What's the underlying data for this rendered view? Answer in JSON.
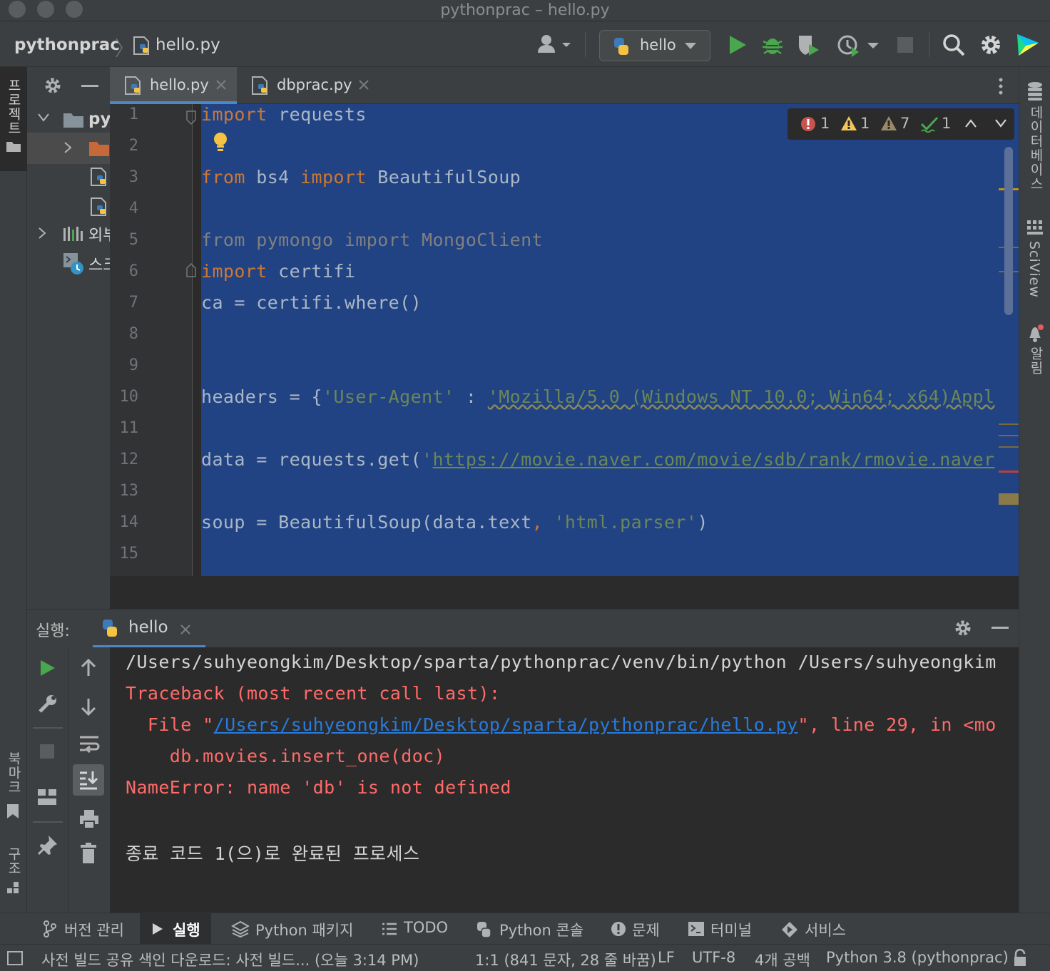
{
  "window": {
    "title": "pythonprac – hello.py"
  },
  "nav": {
    "project": "pythonprac",
    "file": "hello.py",
    "run_config": "hello"
  },
  "left_strip": {
    "project": "프로젝트",
    "bookmarks": "북마크",
    "structure": "구조"
  },
  "right_strip": {
    "database": "데이터베이스",
    "sciview": "SciView",
    "notifications": "알림"
  },
  "project_tree": {
    "root": "py",
    "external": "외부",
    "scratch": "스크"
  },
  "tabs": [
    {
      "label": "hello.py"
    },
    {
      "label": "dbprac.py"
    }
  ],
  "inspections": {
    "errors": "1",
    "warnings": "1",
    "weak_warnings": "7",
    "typos": "1"
  },
  "editor": {
    "line_numbers": [
      "1",
      "2",
      "3",
      "4",
      "5",
      "6",
      "7",
      "8",
      "9",
      "10",
      "11",
      "12",
      "13",
      "14",
      "15"
    ],
    "l1": {
      "kw": "import",
      "rest": " requests"
    },
    "l3": {
      "kw1": "from",
      "mid": " bs4 ",
      "kw2": "import",
      "rest": " BeautifulSoup"
    },
    "l5": {
      "text": "from pymongo import MongoClient"
    },
    "l6": {
      "kw": "import",
      "rest": " certifi"
    },
    "l7": {
      "text": "ca = certifi.where()"
    },
    "l10": {
      "a": "headers = {",
      "b": "'User-Agent'",
      "c": " : ",
      "d": "'Mozilla/5.0 (Windows NT 10.0; Win64; x64)Appl"
    },
    "l12": {
      "a": "data = requests.get(",
      "q": "'",
      "url": "https://movie.naver.com/movie/sdb/rank/rmovie.naver"
    },
    "l14": {
      "a": "soup = BeautifulSoup(data.text",
      "comma": ",",
      "sp": " ",
      "str": "'html.parser'",
      "end": ")"
    }
  },
  "run": {
    "label": "실행:",
    "tab": "hello",
    "output": {
      "cmd": "/Users/suhyeongkim/Desktop/sparta/pythonprac/venv/bin/python /Users/suhyeongkim",
      "tb": "Traceback (most recent call last):",
      "file_pre": "  File \"",
      "file_path": "/Users/suhyeongkim/Desktop/sparta/pythonprac/hello.py",
      "file_post": "\", line 29, in <mo",
      "code": "    db.movies.insert_one(doc)",
      "err": "NameError: name 'db' is not defined",
      "exit": "종료 코드 1(으)로 완료된 프로세스"
    }
  },
  "tool_windows": [
    {
      "label": "버전 관리",
      "icon": "branch-icon"
    },
    {
      "label": "실행",
      "icon": "play-icon"
    },
    {
      "label": "Python 패키지",
      "icon": "layers-icon"
    },
    {
      "label": "TODO",
      "icon": "list-icon"
    },
    {
      "label": "Python 콘솔",
      "icon": "python-icon"
    },
    {
      "label": "문제",
      "icon": "alert-icon"
    },
    {
      "label": "터미널",
      "icon": "terminal-icon"
    },
    {
      "label": "서비스",
      "icon": "services-icon"
    }
  ],
  "status": {
    "message": "사전 빌드 공유 색인 다운로드: 사전 빌드... (오늘 3:14 PM)",
    "position": "1:1 (841 문자, 28 줄 바꿈)",
    "line_sep": "LF",
    "encoding": "UTF-8",
    "indent": "4개 공백",
    "interpreter": "Python 3.8 (pythonprac)"
  },
  "colors": {
    "keyword": "#cc7832",
    "string": "#6a8759",
    "selection": "#214283",
    "error": "#ff6b68",
    "link": "#287bde"
  }
}
